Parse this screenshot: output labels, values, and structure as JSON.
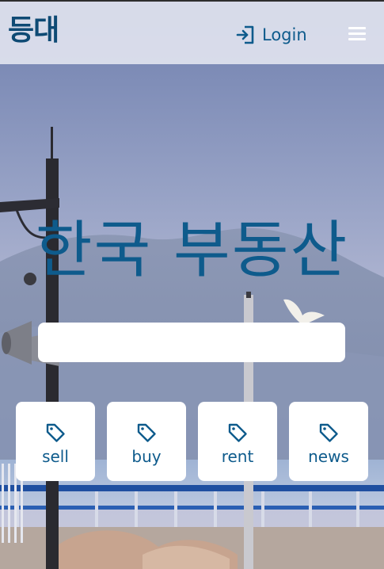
{
  "header": {
    "brand": "등대",
    "login_label": "Login",
    "login_icon": "login-icon",
    "menu_icon": "hamburger-menu-icon"
  },
  "hero": {
    "title": "한국 부동산"
  },
  "search": {
    "value": "",
    "placeholder": ""
  },
  "categories": [
    {
      "label": "sell",
      "icon": "tag-icon"
    },
    {
      "label": "buy",
      "icon": "tag-icon"
    },
    {
      "label": "rent",
      "icon": "tag-icon"
    },
    {
      "label": "news",
      "icon": "tag-icon"
    }
  ],
  "colors": {
    "accent": "#0e5b8c",
    "brand": "#0e4a74",
    "header_bg": "#e2e4f0",
    "card_bg": "#ffffff"
  }
}
